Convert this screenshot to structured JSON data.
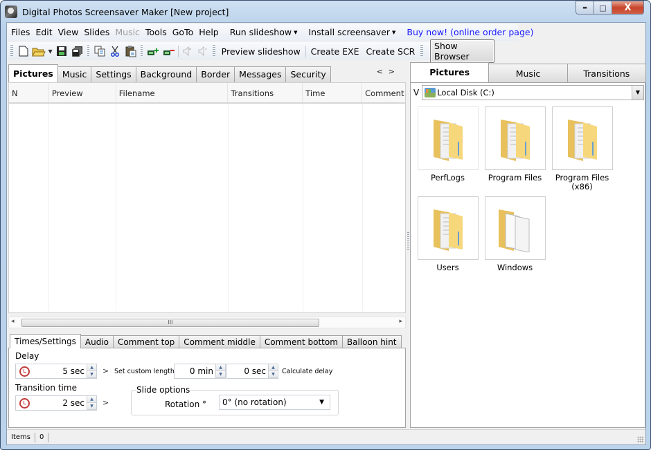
{
  "window": {
    "title": "Digital Photos Screensaver Maker [New project]",
    "controls": {
      "minimize": "▬",
      "maximize": "□",
      "close": "X"
    }
  },
  "menubar": {
    "items": [
      {
        "label": "Files",
        "enabled": true
      },
      {
        "label": "Edit",
        "enabled": true
      },
      {
        "label": "View",
        "enabled": true
      },
      {
        "label": "Slides",
        "enabled": true
      },
      {
        "label": "Music",
        "enabled": false
      },
      {
        "label": "Tools",
        "enabled": true
      },
      {
        "label": "GoTo",
        "enabled": true
      },
      {
        "label": "Help",
        "enabled": true
      }
    ],
    "run_slideshow": "Run slideshow",
    "install_screensaver": "Install screensaver",
    "buy_now": "Buy now! (online order page)",
    "link_color": "#1a1aff"
  },
  "toolbar": {
    "icons": [
      "new-file-icon",
      "open-folder-icon",
      "save-icon",
      "save-all-icon",
      "copy-icon",
      "cut-icon",
      "paste-icon",
      "add-slide-icon",
      "remove-slide-icon",
      "sound-on-icon",
      "sound-off-icon"
    ],
    "preview_slideshow": "Preview slideshow",
    "create_exe": "Create EXE",
    "create_scr": "Create SCR",
    "show_browser": "Show Browser"
  },
  "left_tabs": {
    "items": [
      "Pictures",
      "Music",
      "Settings",
      "Background",
      "Border",
      "Messages",
      "Security"
    ],
    "active": "Pictures",
    "nav_prev": "<",
    "nav_next": ">"
  },
  "grid": {
    "columns": [
      "N",
      "Preview",
      "Filename",
      "Transitions",
      "Time",
      "Comment"
    ],
    "rows": []
  },
  "hscroll": {
    "left": "◂",
    "right": "▸",
    "thumb": "III"
  },
  "bottom_tabs": {
    "items": [
      "Times/Settings",
      "Audio",
      "Comment top",
      "Comment middle",
      "Comment bottom",
      "Balloon hint"
    ],
    "active": "Times/Settings"
  },
  "times": {
    "delay_label": "Delay",
    "delay_value": "5 sec",
    "more": ">",
    "custom_length_label": "Set custom length:",
    "custom_min": "0 min",
    "custom_sec": "0 sec",
    "calculate_delay": "Calculate delay",
    "transition_label": "Transition time",
    "transition_value": "2 sec",
    "slide_options_label": "Slide options",
    "rotation_label": "Rotation °",
    "rotation_value": "0° (no rotation)"
  },
  "browser": {
    "tabs": [
      "Pictures",
      "Music",
      "Transitions"
    ],
    "active": "Pictures",
    "view_label": "V",
    "drive": "Local Disk (C:)",
    "folders": [
      "PerfLogs",
      "Program Files",
      "Program Files (x86)",
      "Users",
      "Windows"
    ]
  },
  "statusbar": {
    "items_label": "Items",
    "count": "0"
  }
}
